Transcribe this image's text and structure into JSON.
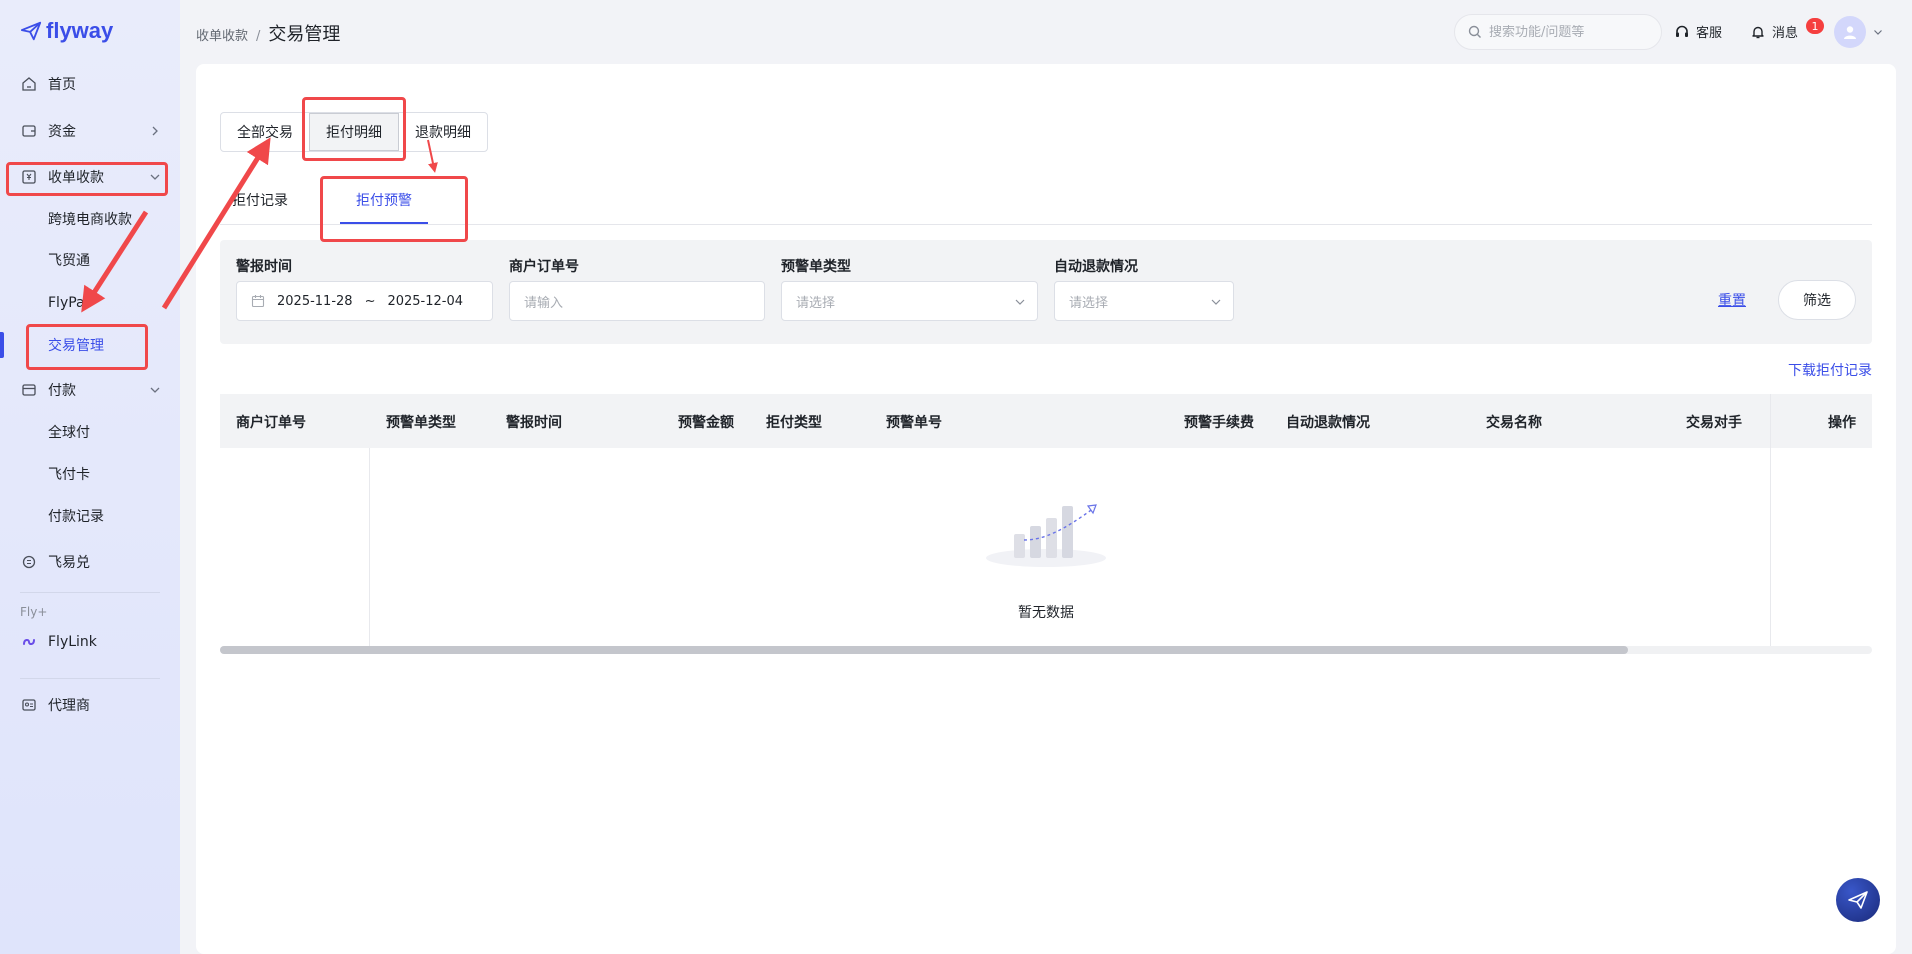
{
  "sidebar": {
    "logo": "flyway",
    "items": [
      {
        "label": "首页",
        "icon": "home-icon"
      },
      {
        "label": "资金",
        "icon": "wallet-icon"
      },
      {
        "label": "收单收款",
        "icon": "receipt-icon"
      },
      {
        "label": "付款",
        "icon": "card-icon"
      },
      {
        "label": "飞易兑",
        "icon": "exchange-icon"
      },
      {
        "label": "FlyLink",
        "icon": "link-icon"
      },
      {
        "label": "代理商",
        "icon": "agent-icon"
      }
    ],
    "receive_sub": [
      "跨境电商收款",
      "飞贸通",
      "FlyPa",
      "交易管理"
    ],
    "pay_sub": [
      "全球付",
      "飞付卡",
      "付款记录"
    ],
    "section_label": "Fly+"
  },
  "header": {
    "breadcrumb_parent": "收单收款",
    "breadcrumb_sep": "/",
    "breadcrumb_current": "交易管理",
    "search_placeholder": "搜索功能/问题等",
    "support_label": "客服",
    "messages_label": "消息",
    "messages_badge": "1"
  },
  "segment_tabs": {
    "all": "全部交易",
    "chargeback": "拒付明细",
    "refund": "退款明细",
    "active": "拒付明细"
  },
  "sub_tabs": {
    "records": "拒付记录",
    "alerts": "拒付预警",
    "active": "拒付预警"
  },
  "filters": {
    "alert_time_label": "警报时间",
    "date_start": "2025-11-28",
    "date_sep": "~",
    "date_end": "2025-12-04",
    "order_no_label": "商户订单号",
    "order_no_placeholder": "请输入",
    "alert_type_label": "预警单类型",
    "alert_type_placeholder": "请选择",
    "auto_refund_label": "自动退款情况",
    "auto_refund_placeholder": "请选择",
    "reset": "重置",
    "filter": "筛选"
  },
  "download_label": "下载拒付记录",
  "table": {
    "columns": [
      "商户订单号",
      "预警单类型",
      "警报时间",
      "预警金额",
      "拒付类型",
      "预警单号",
      "预警手续费",
      "自动退款情况",
      "交易名称",
      "交易对手",
      "操作"
    ],
    "empty_text": "暂无数据"
  },
  "colors": {
    "accent": "#3b4ee8",
    "annotation": "#f0484a"
  }
}
